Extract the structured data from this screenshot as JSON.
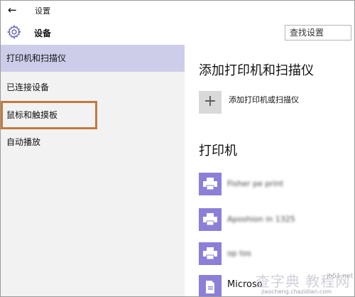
{
  "window": {
    "back_icon": "back-arrow-icon",
    "title": "设置"
  },
  "header": {
    "icon": "gear-icon",
    "title": "设备",
    "search_placeholder": "查找设置"
  },
  "sidebar": {
    "items": [
      {
        "label": "打印机和扫描仪",
        "selected": true
      },
      {
        "label": "已连接设备",
        "selected": false
      },
      {
        "label": "鼠标和触摸板",
        "selected": false
      },
      {
        "label": "自动播放",
        "selected": false
      }
    ],
    "highlight_color": "#c27a40",
    "selected_color": "#cdcde9"
  },
  "main": {
    "add_section_title": "添加打印机和扫描仪",
    "add_button_symbol": "+",
    "add_button_label": "添加打印机或扫描仪",
    "printers_title": "打印机",
    "printers": [
      {
        "name": "Fisher pe print",
        "blurred": true
      },
      {
        "name": "Aposhion in 1325",
        "blurred": true
      },
      {
        "name": "op tos",
        "blurred": true
      },
      {
        "name": "Microso",
        "blurred": false
      }
    ],
    "printer_tile_color": "#8c7fd8"
  },
  "watermark": {
    "main": "查字典 教程网",
    "site": "jb51.net",
    "url": "jiaocheng.chazidian.com"
  }
}
